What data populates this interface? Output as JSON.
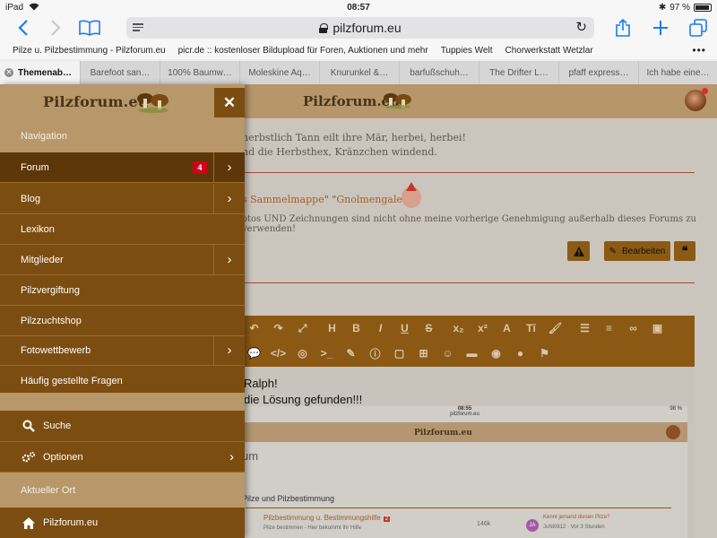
{
  "status_bar": {
    "device": "iPad",
    "time": "08:57",
    "battery": "97 %"
  },
  "toolbar": {
    "back_icon": "chevron-left-icon",
    "forward_icon": "chevron-right-icon",
    "bookmarks_icon": "open-book-icon",
    "url": "pilzforum.eu",
    "share_icon": "share-icon",
    "new_tab_icon": "plus-icon",
    "tabs_icon": "tabs-overview-icon",
    "accent_color": "#1a7cf5"
  },
  "bookmarks": [
    "Pilze u. Pilzbestimmung - Pilzforum.eu",
    "picr.de :: kostenloser Bildupload für Foren, Auktionen und mehr",
    "Tuppies Welt",
    "Chorwerkstatt Wetzlar"
  ],
  "tabs": [
    "Themenab…",
    "Barefoot san…",
    "100% Baumw…",
    "Moleskine Aq…",
    "Knurunkel &…",
    "barfußschuh…",
    "The Drifter L…",
    "pfaff express…",
    "Ich habe eine…"
  ],
  "page": {
    "logo": "Pilzforum.eu",
    "poem_line1": "herbstlich Tann eilt ihre Mär, herbei, herbei!",
    "poem_line2": "nd die Herbsthex, Kränzchen windend.",
    "sig_link1": "s Sammelmappe",
    "sig_mid": "\" \"",
    "sig_link2": "Gnolmengalerie",
    "sig_end": "\"",
    "notice": "otos UND Zeichnungen sind nicht ohne meine vorherige Genehmigung außerhalb dieses Forums zu verwenden!",
    "edit_button": "Bearbeiten",
    "editor_text_line1": "Ralph!",
    "editor_text_line2": "die Lösung gefunden!!!",
    "screenshot": {
      "time": "08:55",
      "url": "pilzforum.eu",
      "battery": "98 %",
      "logo": "Pilzforum.eu",
      "heading_fragment": "um",
      "section": "Pilze und Pilzbestimmung",
      "forum_title": "Pilzbestimmung u. Bestimmungshilfe",
      "forum_badge": "2",
      "forum_desc": "Pilze bestimmen - Hier bekommt Ihr Hilfe",
      "count": "146k",
      "avatar_initials": "JA",
      "last_post_title": "Kennt jemand diesen Pilze?",
      "last_post_user": "JuNi0812 · Vor 3 Stunden"
    }
  },
  "drawer": {
    "logo": "Pilzforum.eu",
    "close_icon": "close-icon",
    "section_navigation": "Navigation",
    "items": [
      {
        "label": "Forum",
        "badge": "4",
        "has_submenu": true,
        "active": true
      },
      {
        "label": "Blog",
        "has_submenu": true
      },
      {
        "label": "Lexikon",
        "has_submenu": false
      },
      {
        "label": "Mitglieder",
        "has_submenu": true
      },
      {
        "label": "Pilzvergiftung",
        "has_submenu": false
      },
      {
        "label": "Pilzzuchtshop",
        "has_submenu": false
      },
      {
        "label": "Fotowettbewerb",
        "has_submenu": true
      },
      {
        "label": "Häufig gestellte Fragen",
        "has_submenu": false
      }
    ],
    "search_label": "Suche",
    "options_label": "Optionen",
    "section_location": "Aktueller Ort",
    "location_label": "Pilzforum.eu",
    "colors": {
      "drawer_bg": "#7c4d10",
      "active_bg": "#5d3609",
      "header_bg": "#b8976a",
      "badge": "#d0021b"
    }
  }
}
